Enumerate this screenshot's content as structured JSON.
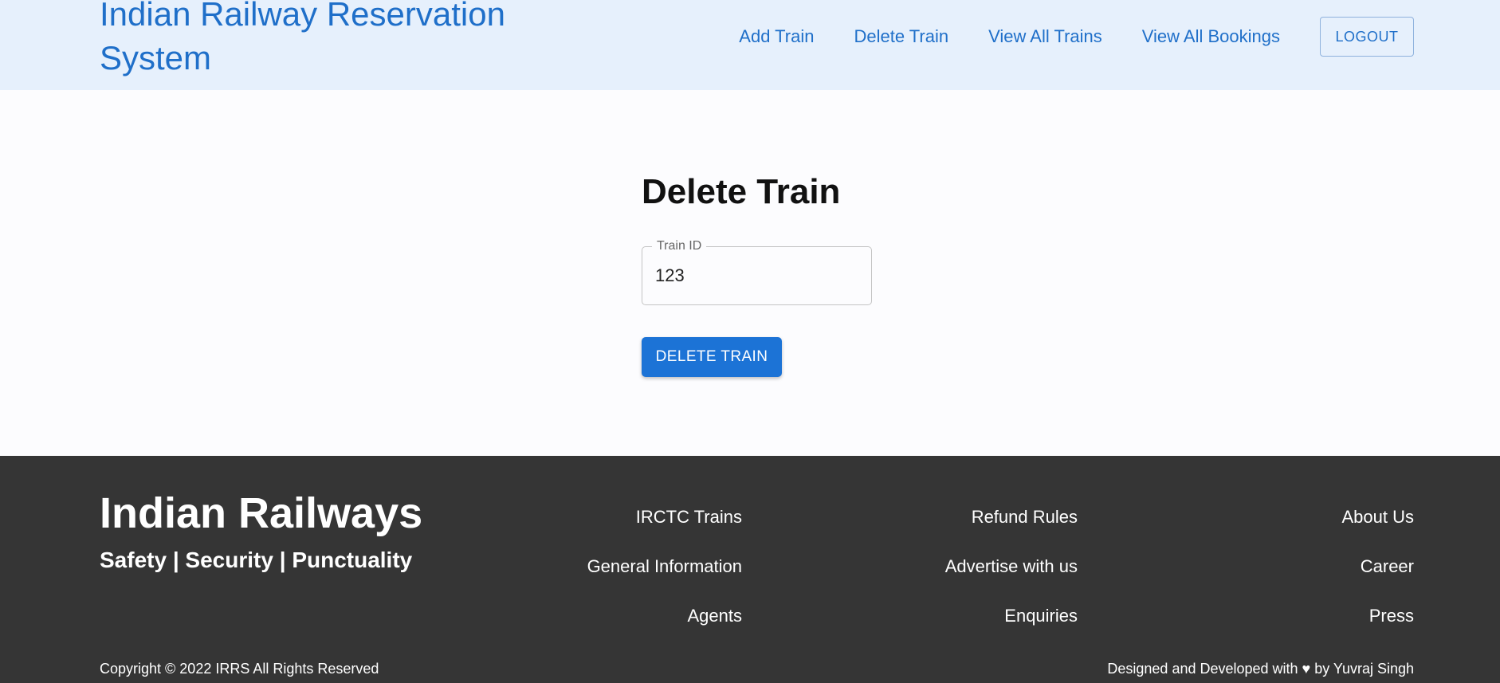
{
  "header": {
    "brand": "Indian Railway Reservation System",
    "nav": [
      {
        "label": "Add Train"
      },
      {
        "label": "Delete Train"
      },
      {
        "label": "View All Trains"
      },
      {
        "label": "View All Bookings"
      }
    ],
    "logout_label": "LOGOUT"
  },
  "form": {
    "title": "Delete Train",
    "train_id_label": "Train ID",
    "train_id_value": "123",
    "submit_label": "DELETE TRAIN"
  },
  "footer": {
    "brand": "Indian Railways",
    "tagline": "Safety | Security | Punctuality",
    "columns": [
      {
        "links": [
          "IRCTC Trains",
          "General Information",
          "Agents"
        ]
      },
      {
        "links": [
          "Refund Rules",
          "Advertise with us",
          "Enquiries"
        ]
      },
      {
        "links": [
          "About Us",
          "Career",
          "Press"
        ]
      }
    ],
    "copyright": "Copyright © 2022 IRRS All Rights Reserved",
    "credit": "Designed and Developed with ♥ by Yuvraj Singh"
  },
  "colors": {
    "primary": "#1f6fc9",
    "header_bg": "#e6f0fc",
    "button_bg": "#1c73d6",
    "footer_bg": "#353535"
  }
}
